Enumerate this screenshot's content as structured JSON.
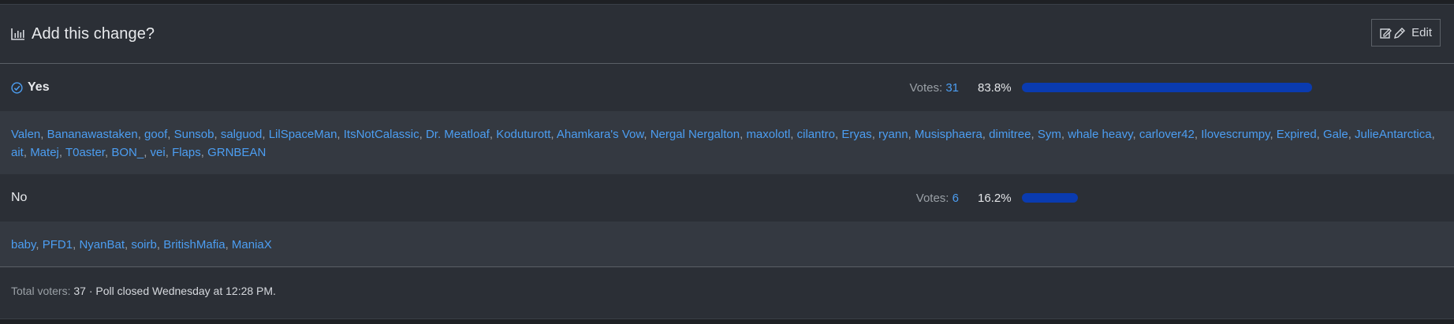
{
  "poll": {
    "title": "Add this change?",
    "edit_label": "Edit",
    "options": [
      {
        "label": "Yes",
        "selected": true,
        "votes_label": "Votes:",
        "votes": "31",
        "percent": "83.8%",
        "fraction": 0.838,
        "voters": [
          "Valen",
          "Bananawastaken",
          "goof",
          "Sunsob",
          "salguod",
          "LilSpaceMan",
          "ItsNotCalassic",
          "Dr. Meatloaf",
          "Koduturott",
          "Ahamkara's Vow",
          "Nergal Nergalton",
          "maxolotl",
          "cilantro",
          "Eryas",
          "ryann",
          "Musisphaera",
          "dimitree",
          "Sym",
          "whale heavy",
          "carlover42",
          "Ilovescrumpy",
          "Expired",
          "Gale",
          "JulieAntarctica",
          "ait",
          "Matej",
          "T0aster",
          "BON_",
          "vei",
          "Flaps",
          "GRNBEAN"
        ]
      },
      {
        "label": "No",
        "selected": false,
        "votes_label": "Votes:",
        "votes": "6",
        "percent": "16.2%",
        "fraction": 0.162,
        "voters": [
          "baby",
          "PFD1",
          "NyanBat",
          "soirb",
          "BritishMafia",
          "ManiaX"
        ]
      }
    ],
    "footer": {
      "total_label": "Total voters:",
      "total": "37",
      "closed_text": "· Poll closed Wednesday at 12:28 PM."
    }
  },
  "colors": {
    "accent": "#4c9ef2",
    "bar": "#0a3bb0",
    "panel": "#2b2f36",
    "voters_bg": "#343941"
  },
  "icons": {
    "title": "bar-chart-icon",
    "edit": "edit-pencil-icon",
    "selected": "check-circle-icon"
  }
}
